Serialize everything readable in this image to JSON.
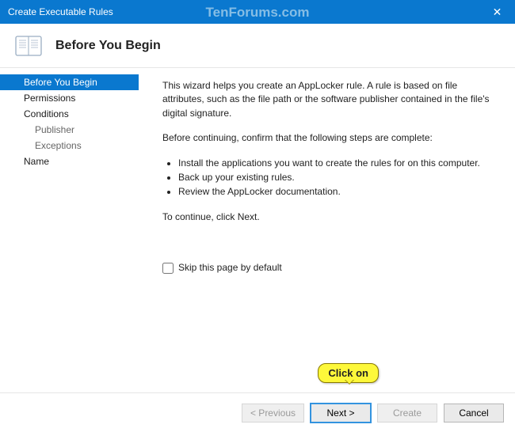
{
  "window": {
    "title": "Create Executable Rules",
    "close_glyph": "✕"
  },
  "watermark": "TenForums.com",
  "header": {
    "title": "Before You Begin"
  },
  "sidebar": {
    "items": [
      {
        "label": "Before You Begin",
        "selected": true
      },
      {
        "label": "Permissions",
        "selected": false
      },
      {
        "label": "Conditions",
        "selected": false
      },
      {
        "label": "Publisher",
        "selected": false,
        "sub": true
      },
      {
        "label": "Exceptions",
        "selected": false,
        "sub": true
      },
      {
        "label": "Name",
        "selected": false
      }
    ]
  },
  "content": {
    "intro": "This wizard helps you create an AppLocker rule. A rule is based on file attributes, such as the file path or the software publisher contained in the file's digital signature.",
    "before_line": "Before continuing, confirm that the following steps are complete:",
    "bullets": [
      "Install the applications you want to create the rules for on this computer.",
      "Back up your existing rules.",
      "Review the AppLocker documentation."
    ],
    "continue_line": "To continue, click Next.",
    "skip_label": "Skip this page by default"
  },
  "footer": {
    "previous": "< Previous",
    "next": "Next >",
    "create": "Create",
    "cancel": "Cancel"
  },
  "annotation": {
    "callout": "Click on"
  }
}
